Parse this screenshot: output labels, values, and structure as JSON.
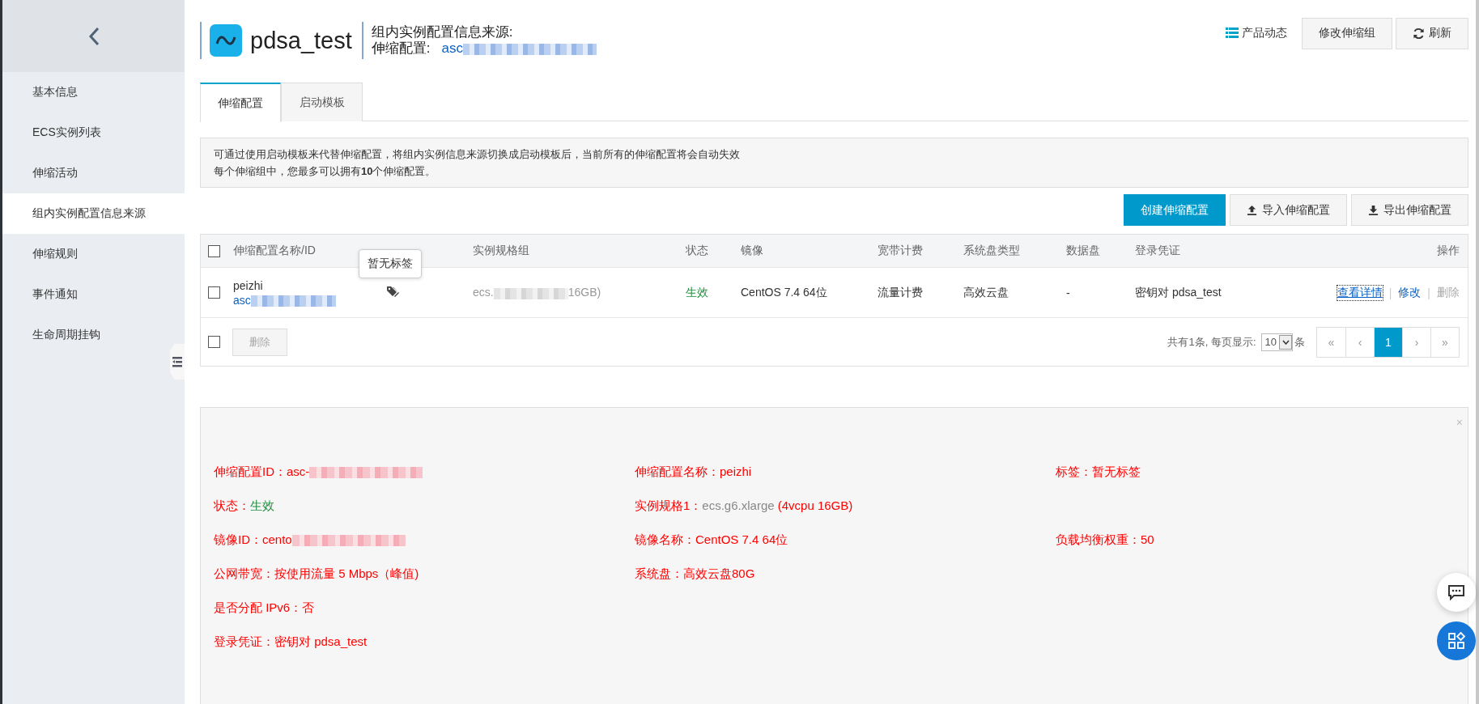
{
  "sidebar": {
    "items": [
      {
        "label": "基本信息",
        "selected": false
      },
      {
        "label": "ECS实例列表",
        "selected": false
      },
      {
        "label": "伸缩活动",
        "selected": false
      },
      {
        "label": "组内实例配置信息来源",
        "selected": true
      },
      {
        "label": "伸缩规则",
        "selected": false
      },
      {
        "label": "事件通知",
        "selected": false
      },
      {
        "label": "生命周期挂钩",
        "selected": false
      }
    ]
  },
  "header": {
    "title": "pdsa_test",
    "source_label": "组内实例配置信息来源:",
    "config_label": "伸缩配置:",
    "config_value": "asc",
    "config_redacted": true,
    "news_link": "产品动态",
    "buttons": [
      {
        "label": "修改伸缩组",
        "kind": "plain"
      },
      {
        "label": "刷新",
        "kind": "refresh"
      }
    ]
  },
  "tabs": [
    {
      "label": "伸缩配置",
      "selected": true
    },
    {
      "label": "启动模板",
      "selected": false
    }
  ],
  "notice": {
    "line_1": "可通过使用启动模板来代替伸缩配置，将组内实例信息来源切换成启动模板后，当前所有的伸缩配置将会自动失效",
    "line_2": "每个伸缩组中，您最多可以拥有**10**个伸缩配置。"
  },
  "actions": [
    {
      "label": "创建伸缩配置",
      "kind": "primary"
    },
    {
      "label": "导入伸缩配置",
      "kind": "upload"
    },
    {
      "label": "导出伸缩配置",
      "kind": "download"
    }
  ],
  "table": {
    "columns": [
      "伸缩配置名称/ID",
      "实例规格组",
      "状态",
      "镜像",
      "宽带计费",
      "系统盘类型",
      "数据盘",
      "登录凭证",
      "操作"
    ],
    "header_checked": false,
    "rows": [
      {
        "checked": false,
        "name": "peizhi",
        "id": "asc",
        "id_redacted": true,
        "tag_tooltip": "暂无标签",
        "spec_start": "ecs.",
        "spec_end": "16GB)",
        "status": "生效",
        "image": "CentOS 7.4 64位",
        "bandwidth": "流量计费",
        "disk": "高效云盘",
        "data_disk": "-",
        "credential": "密钥对 pdsa_test",
        "links": [
          {
            "label": "查看详情",
            "disabled": false,
            "focused": true
          },
          {
            "separator": "|",
            "label": "修改",
            "disabled": false,
            "focused": false
          },
          {
            "separator": "|",
            "label": "删除",
            "disabled": true,
            "focused": false
          }
        ]
      }
    ],
    "footer": {
      "checked": false,
      "delete_button": "删除",
      "delete_disabled": true,
      "summary": "共有1条, 每页显示:",
      "page_size": "10",
      "page_size_suffix": "条",
      "pages": [
        {
          "label": "«",
          "selected": false
        },
        {
          "label": "‹",
          "selected": false
        },
        {
          "label": "1",
          "selected": true
        },
        {
          "label": "›",
          "selected": false
        },
        {
          "label": "»",
          "selected": false
        }
      ]
    }
  },
  "detail": {
    "close": "×",
    "rows": [
      {
        "left": {
          "label": "伸缩配置ID：",
          "value": [
            {
              "text": "asc-",
              "color": "#ff0000"
            }
          ],
          "redacted": true
        },
        "middle": {
          "label": "伸缩配置名称：",
          "value": [
            {
              "text": "peizhi",
              "color": "#ff0000"
            }
          ]
        },
        "right": {
          "label": "标签：",
          "value": [
            {
              "text": "暂无标签",
              "color": "#ff0000"
            }
          ]
        }
      },
      {
        "left": {
          "label": "状态：",
          "value": [
            {
              "text": "生效",
              "color": "#1e8e3e"
            }
          ]
        },
        "middle": {
          "label": "实例规格1：",
          "value": [
            {
              "text": "ecs.g6.xlarge",
              "color": "#888888"
            },
            {
              "text": " (4vcpu 16GB)",
              "color": "#ff0000"
            }
          ]
        }
      },
      {
        "left": {
          "label": "镜像ID：",
          "value": [
            {
              "text": "cento",
              "color": "#ff0000"
            }
          ],
          "redacted": true
        },
        "middle": {
          "label": "镜像名称：",
          "value": [
            {
              "text": "CentOS 7.4 64位",
              "color": "#ff0000"
            }
          ]
        },
        "right": {
          "label": "负载均衡权重：",
          "value": [
            {
              "text": "50",
              "color": "#ff0000"
            }
          ]
        }
      },
      {
        "left": {
          "label": "公网带宽：",
          "value": [
            {
              "text": "按使用流量 5 Mbps（峰值)",
              "color": "#ff0000"
            }
          ]
        },
        "middle": {
          "label": "系统盘：",
          "value": [
            {
              "text": "高效云盘80G",
              "color": "#ff0000"
            }
          ]
        }
      },
      {
        "left": {
          "label": "是否分配 IPv6：",
          "value": [
            {
              "text": "否",
              "color": "#ff0000"
            }
          ]
        }
      },
      {
        "left": {
          "label": "登录凭证：",
          "value": [
            {
              "text": "密钥对 pdsa_test",
              "color": "#ff0000"
            }
          ]
        }
      }
    ]
  }
}
